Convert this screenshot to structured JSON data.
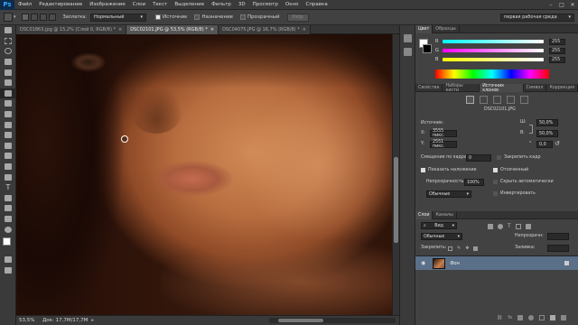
{
  "app": {
    "logo": "Ps",
    "menu": [
      "Файл",
      "Редактирование",
      "Изображение",
      "Слои",
      "Текст",
      "Выделение",
      "Фильтр",
      "3D",
      "Просмотр",
      "Окно",
      "Справка"
    ],
    "window_controls": [
      "–",
      "□",
      "✕"
    ]
  },
  "options_bar": {
    "sample_label": "Заплатка:",
    "mode_value": "Нормальный",
    "source_label": "Источник",
    "destination_label": "Назначение",
    "transparent_label": "Прозрачный",
    "pattern_label": "Узор",
    "workspace": "первая рабочая среда"
  },
  "tabs": [
    {
      "label": "DSC01863.jpg @ 15,2% (Слой 0, RGB/8) *",
      "active": false
    },
    {
      "label": "DSC02101.JPG @ 53,5% (RGB/8) *",
      "active": true
    },
    {
      "label": "DSC04075.JPG @ 16,7% (RGB/8) *",
      "active": false
    }
  ],
  "status": {
    "zoom": "53,5%",
    "doc": "Док: 17,7М/17,7М"
  },
  "color_panel": {
    "tabs": [
      "Цвет",
      "Образцы"
    ],
    "channels": [
      {
        "label": "R",
        "value": "255",
        "gradient": "linear-gradient(90deg,#00ffff,#ffffff)"
      },
      {
        "label": "G",
        "value": "255",
        "gradient": "linear-gradient(90deg,#ff00ff,#ffffff)"
      },
      {
        "label": "B",
        "value": "255",
        "gradient": "linear-gradient(90deg,#ffff00,#ffffff)"
      }
    ]
  },
  "clone_panel": {
    "tabs": [
      "Свойства",
      "Наборы кисти",
      "Источник клонов",
      "Символ",
      "Коррекция"
    ],
    "source_file": "DSC02101.JPG",
    "offset_label": "Источник:",
    "x_label": "X:",
    "x_value": "3555 пикс.",
    "y_label": "Y:",
    "y_value": "2551 пикс.",
    "w_label": "Ш:",
    "w_value": "50,0%",
    "h_label": "В:",
    "h_value": "50,0%",
    "angle_value": "0,0",
    "angle_unit": "°",
    "frame_offset_label": "Смещение по кадрам:",
    "frame_offset_value": "0",
    "lock_frame_label": "Закрепить кадр",
    "show_overlay_label": "Показать наложение",
    "opacity_label": "Непрозрачность:",
    "opacity_value": "100%",
    "clipped_label": "Отсеченный",
    "autohide_label": "Скрыть автоматически",
    "blend_value": "Обычные",
    "invert_label": "Инвертировать"
  },
  "layers_panel": {
    "tabs": [
      "Слои",
      "Каналы"
    ],
    "kind_label": "Вид",
    "blend_value": "Обычные",
    "opacity_label": "Непрозрачн:",
    "lock_label": "Закрепить:",
    "fill_label": "Заливка:",
    "layer_name": "Фон"
  }
}
